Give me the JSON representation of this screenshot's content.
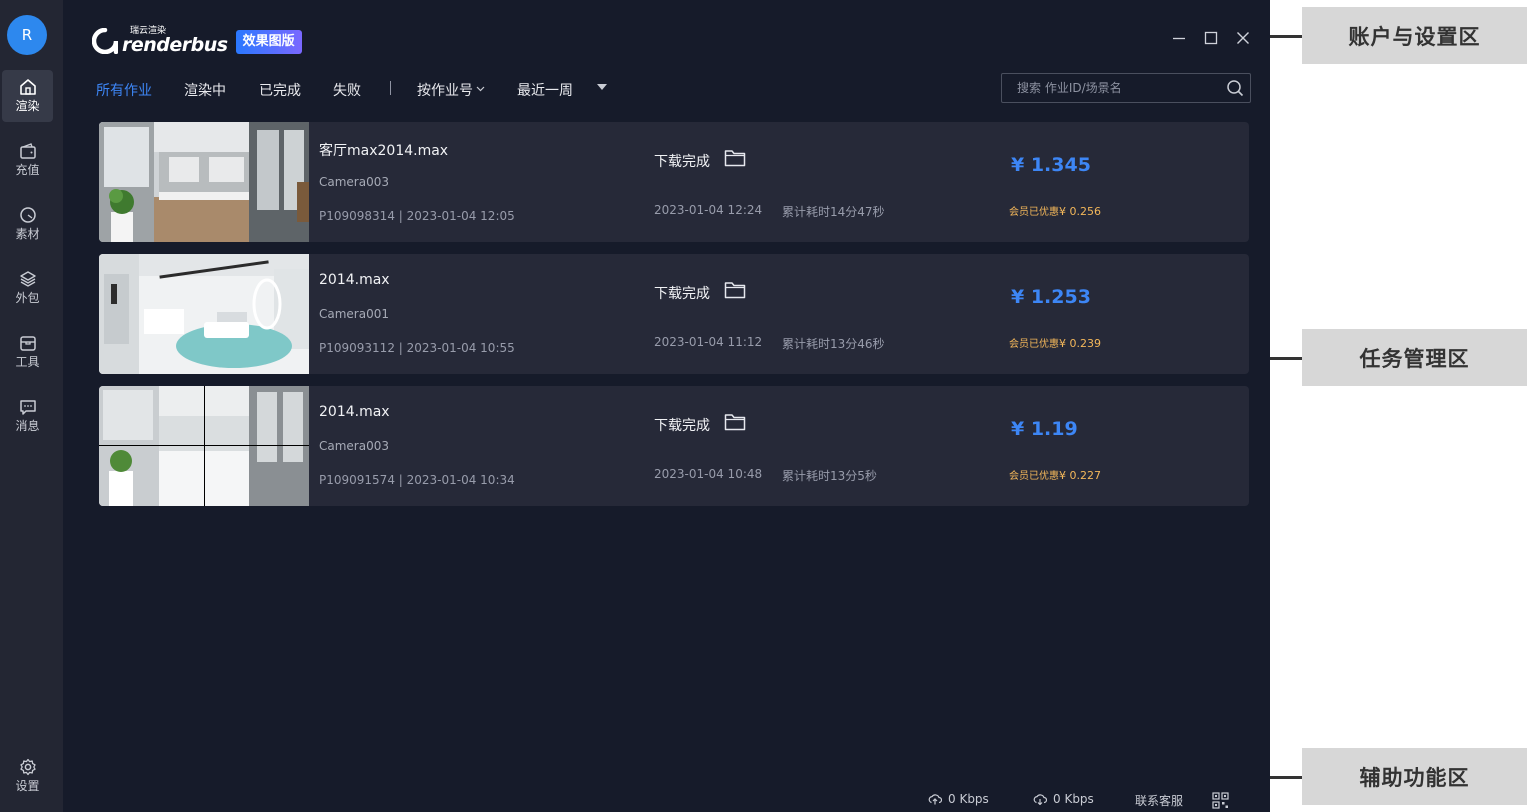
{
  "app": {
    "avatar_letter": "R",
    "logo_cn": "瑞云渲染",
    "logo_en": "renderbus",
    "edition_badge": "效果图版"
  },
  "sidebar": {
    "items": [
      {
        "label": "渲染",
        "icon": "home-icon",
        "active": true
      },
      {
        "label": "充值",
        "icon": "wallet-icon"
      },
      {
        "label": "素材",
        "icon": "material-icon"
      },
      {
        "label": "外包",
        "icon": "layers-icon"
      },
      {
        "label": "工具",
        "icon": "toolbox-icon"
      },
      {
        "label": "消息",
        "icon": "message-icon"
      }
    ],
    "settings_label": "设置"
  },
  "tabs": {
    "all": "所有作业",
    "rendering": "渲染中",
    "done": "已完成",
    "failed": "失败",
    "sort": "按作业号",
    "range": "最近一周"
  },
  "search": {
    "placeholder": "搜索 作业ID/场景名"
  },
  "jobs": [
    {
      "file": "客厅max2014.max",
      "camera": "Camera003",
      "job_meta": "P109098314 | 2023-01-04 12:05",
      "status": "下载完成",
      "end_time": "2023-01-04 12:24",
      "duration": "累计耗时14分47秒",
      "price": "¥ 1.345",
      "discount_label": "会员已优惠",
      "discount_value": "¥ 0.256"
    },
    {
      "file": "2014.max",
      "camera": "Camera001",
      "job_meta": "P109093112 | 2023-01-04 10:55",
      "status": "下载完成",
      "end_time": "2023-01-04 11:12",
      "duration": "累计耗时13分46秒",
      "price": "¥ 1.253",
      "discount_label": "会员已优惠",
      "discount_value": "¥ 0.239"
    },
    {
      "file": "2014.max",
      "camera": "Camera003",
      "job_meta": "P109091574 | 2023-01-04 10:34",
      "status": "下载完成",
      "end_time": "2023-01-04 10:48",
      "duration": "累计耗时13分5秒",
      "price": "¥ 1.19",
      "discount_label": "会员已优惠",
      "discount_value": "¥ 0.227"
    }
  ],
  "footer": {
    "upload_speed": "0 Kbps",
    "download_speed": "0 Kbps",
    "support": "联系客服"
  },
  "callouts": {
    "account": "账户与设置区",
    "tasks": "任务管理区",
    "aux": "辅助功能区"
  },
  "colors": {
    "accent": "#3d86f5",
    "discount": "#f3b75a",
    "background": "#161b2a",
    "card": "#262938"
  }
}
